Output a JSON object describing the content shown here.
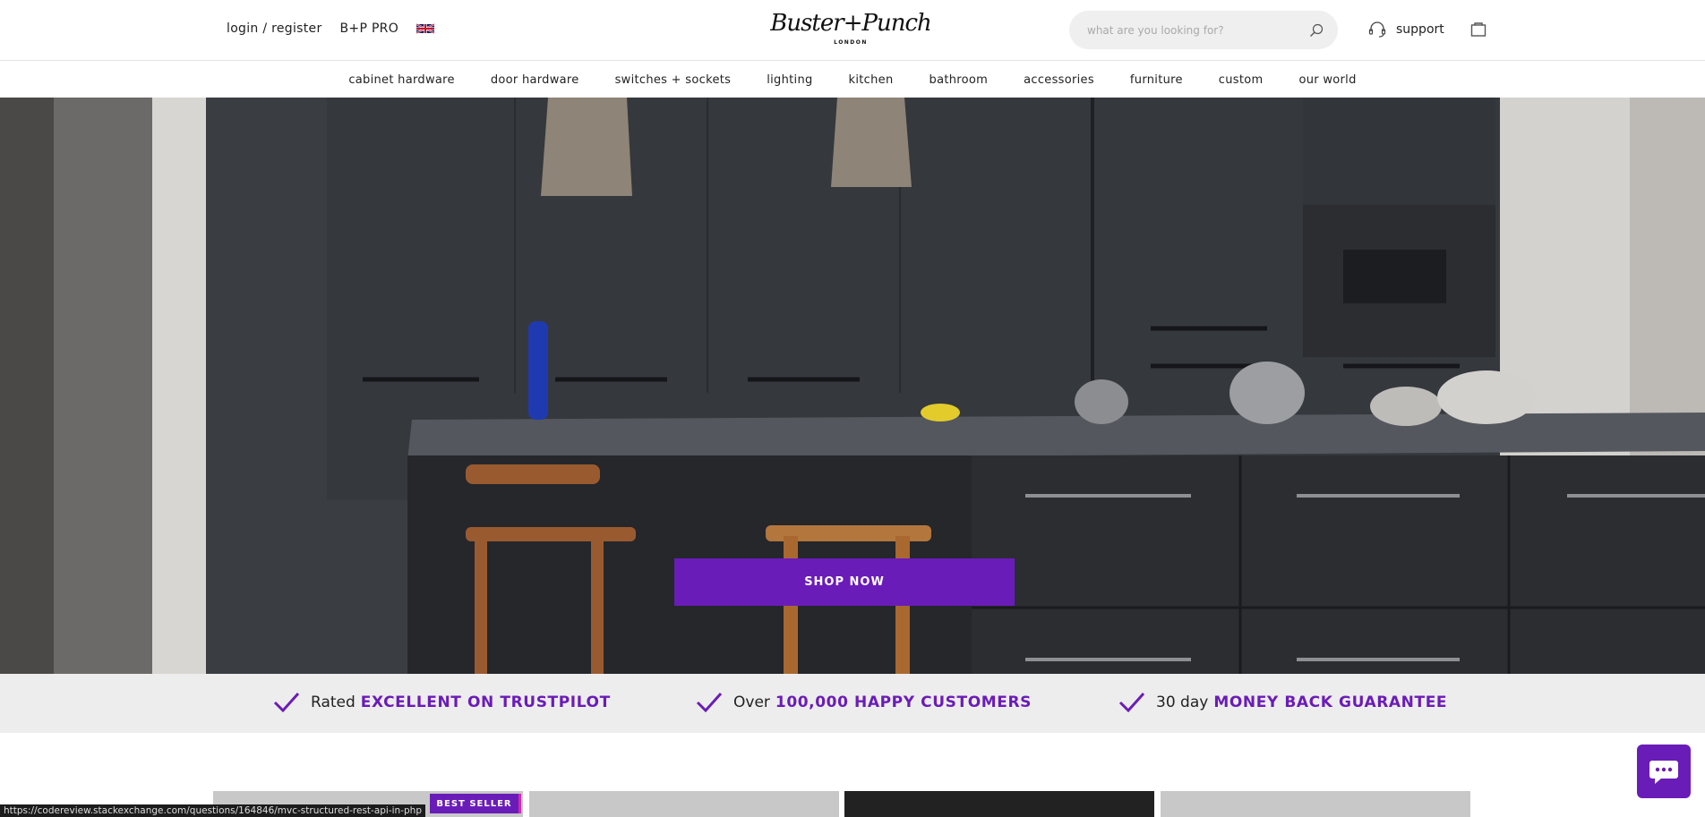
{
  "header": {
    "login_label": "login / register",
    "pro_label": "B+P PRO",
    "logo_text": "Buster+Punch",
    "logo_sub": "LONDON",
    "search_placeholder": "what are you looking for?",
    "support_label": "support"
  },
  "nav": {
    "items": [
      "cabinet hardware",
      "door hardware",
      "switches + sockets",
      "lighting",
      "kitchen",
      "bathroom",
      "accessories",
      "furniture",
      "custom",
      "our world"
    ]
  },
  "hero": {
    "cta_label": "SHOP NOW"
  },
  "usp": [
    {
      "lead": "Rated",
      "highlight": "EXCELLENT ON TRUSTPILOT"
    },
    {
      "lead": "Over",
      "highlight": "100,000 HAPPY CUSTOMERS"
    },
    {
      "lead": "30 day",
      "highlight": "MONEY BACK GUARANTEE"
    }
  ],
  "products": {
    "badge": "BEST SELLER"
  },
  "status_bar": {
    "url": "https://codereview.stackexchange.com/questions/164846/mvc-structured-rest-api-in-php"
  },
  "colors": {
    "accent": "#6a1cb8",
    "usp_bg": "#ededed"
  },
  "icons": {
    "flag": "uk-flag-icon",
    "search": "search-icon",
    "support": "headset-icon",
    "bag": "bag-icon",
    "check": "check-icon",
    "chat": "chat-icon"
  }
}
